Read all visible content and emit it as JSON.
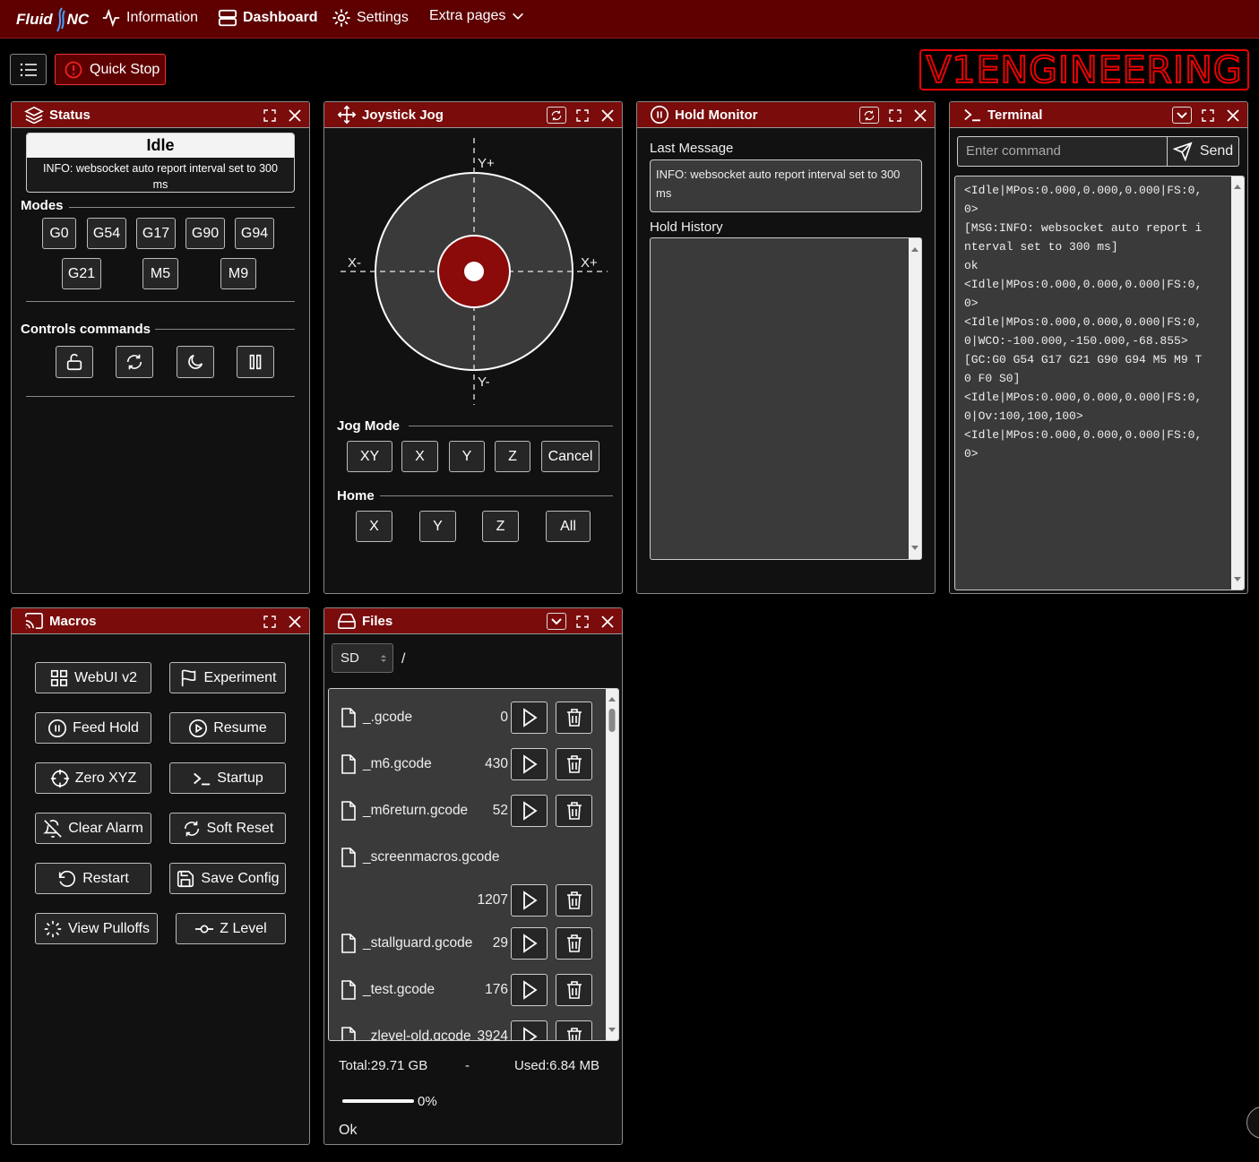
{
  "nav": {
    "brand_left": "Fluid",
    "brand_right": "NC",
    "information": "Information",
    "dashboard": "Dashboard",
    "settings": "Settings",
    "extra_pages": "Extra pages"
  },
  "toolbar": {
    "quick_stop": "Quick Stop",
    "logo_text": "V1ENGINEERING"
  },
  "status": {
    "title": "Status",
    "state": "Idle",
    "message": "INFO: websocket auto report interval set to 300 ms",
    "modes_label": "Modes",
    "modes": [
      "G0",
      "G54",
      "G17",
      "G90",
      "G94",
      "G21",
      "M5",
      "M9"
    ],
    "controls_label": "Controls commands"
  },
  "jog": {
    "title": "Joystick Jog",
    "y_plus": "Y+",
    "y_minus": "Y-",
    "x_plus": "X+",
    "x_minus": "X-",
    "jog_mode_label": "Jog Mode",
    "jog_modes": [
      "XY",
      "X",
      "Y",
      "Z",
      "Cancel"
    ],
    "home_label": "Home",
    "home": [
      "X",
      "Y",
      "Z",
      "All"
    ]
  },
  "hold": {
    "title": "Hold Monitor",
    "last_message_label": "Last Message",
    "last_message": "INFO: websocket auto report interval set to 300 ms",
    "history_label": "Hold History"
  },
  "terminal": {
    "title": "Terminal",
    "placeholder": "Enter command",
    "send": "Send",
    "lines": [
      "<Idle|MPos:0.000,0.000,0.000|FS:0,",
      "0>",
      "[MSG:INFO: websocket auto report i",
      "nterval set to 300 ms]",
      "ok",
      "<Idle|MPos:0.000,0.000,0.000|FS:0,",
      "0>",
      "<Idle|MPos:0.000,0.000,0.000|FS:0,",
      "0|WCO:-100.000,-150.000,-68.855>",
      "[GC:G0 G54 G17 G21 G90 G94 M5 M9 T",
      "0 F0 S0]",
      "<Idle|MPos:0.000,0.000,0.000|FS:0,",
      "0|Ov:100,100,100>",
      "<Idle|MPos:0.000,0.000,0.000|FS:0,",
      "0>"
    ]
  },
  "macros": {
    "title": "Macros",
    "items": [
      {
        "label": "WebUI v2",
        "icon": "grid-icon"
      },
      {
        "label": "Experiment",
        "icon": "flag-icon"
      },
      {
        "label": "Feed Hold",
        "icon": "pause-circle-icon"
      },
      {
        "label": "Resume",
        "icon": "play-circle-icon"
      },
      {
        "label": "Zero XYZ",
        "icon": "crosshair-icon"
      },
      {
        "label": "Startup",
        "icon": "terminal-icon"
      },
      {
        "label": "Clear Alarm",
        "icon": "bell-off-icon"
      },
      {
        "label": "Soft Reset",
        "icon": "refresh-icon"
      },
      {
        "label": "Restart",
        "icon": "rotate-ccw-icon"
      },
      {
        "label": "Save Config",
        "icon": "save-icon"
      },
      {
        "label": "View Pulloffs",
        "icon": "loader-icon"
      },
      {
        "label": "Z Level",
        "icon": "git-commit-icon"
      }
    ]
  },
  "files": {
    "title": "Files",
    "source": "SD",
    "path": "/",
    "items": [
      {
        "name": "_.gcode",
        "size": "0"
      },
      {
        "name": "_m6.gcode",
        "size": "430"
      },
      {
        "name": "_m6return.gcode",
        "size": "52"
      },
      {
        "name": "_screenmacros.gcode",
        "size": "1207"
      },
      {
        "name": "_stallguard.gcode",
        "size": "29"
      },
      {
        "name": "_test.gcode",
        "size": "176"
      },
      {
        "name": "_zlevel-old.gcode",
        "size": "3924"
      }
    ],
    "total": "Total:29.71 GB",
    "separator": "-",
    "used": "Used:6.84 MB",
    "progress": 0,
    "progress_text": "0%",
    "status": "Ok"
  },
  "colors": {
    "accent": "#7a0c0c",
    "nav": "#5e0000",
    "joystick_center": "#8b0a0a"
  }
}
